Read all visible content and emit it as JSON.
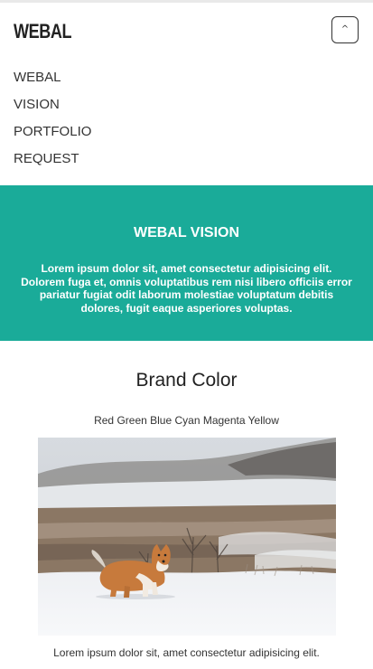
{
  "header": {
    "brand": "WEBAL",
    "toggle_glyph": "^"
  },
  "nav": {
    "items": [
      {
        "label": "WEBAL"
      },
      {
        "label": "VISION"
      },
      {
        "label": "PORTFOLIO"
      },
      {
        "label": "REQUEST"
      }
    ]
  },
  "hero": {
    "title": "WEBAL VISION",
    "text": "Lorem ipsum dolor sit, amet consectetur adipisicing elit. Dolorem fuga et, omnis voluptatibus rem nisi libero officiis error pariatur fugiat odit laborum molestiae voluptatum debitis dolores, fugit eaque asperiores voluptas.",
    "background_color": "#1aab99"
  },
  "brand_section": {
    "title": "Brand Color",
    "colors_text": "Red Green Blue Cyan Magenta Yellow",
    "caption": "Lorem ipsum dolor sit, amet consectetur adipisicing elit."
  },
  "icons": {
    "menu_toggle": "caret-up-icon",
    "photo": "corgi-in-snow-image"
  }
}
